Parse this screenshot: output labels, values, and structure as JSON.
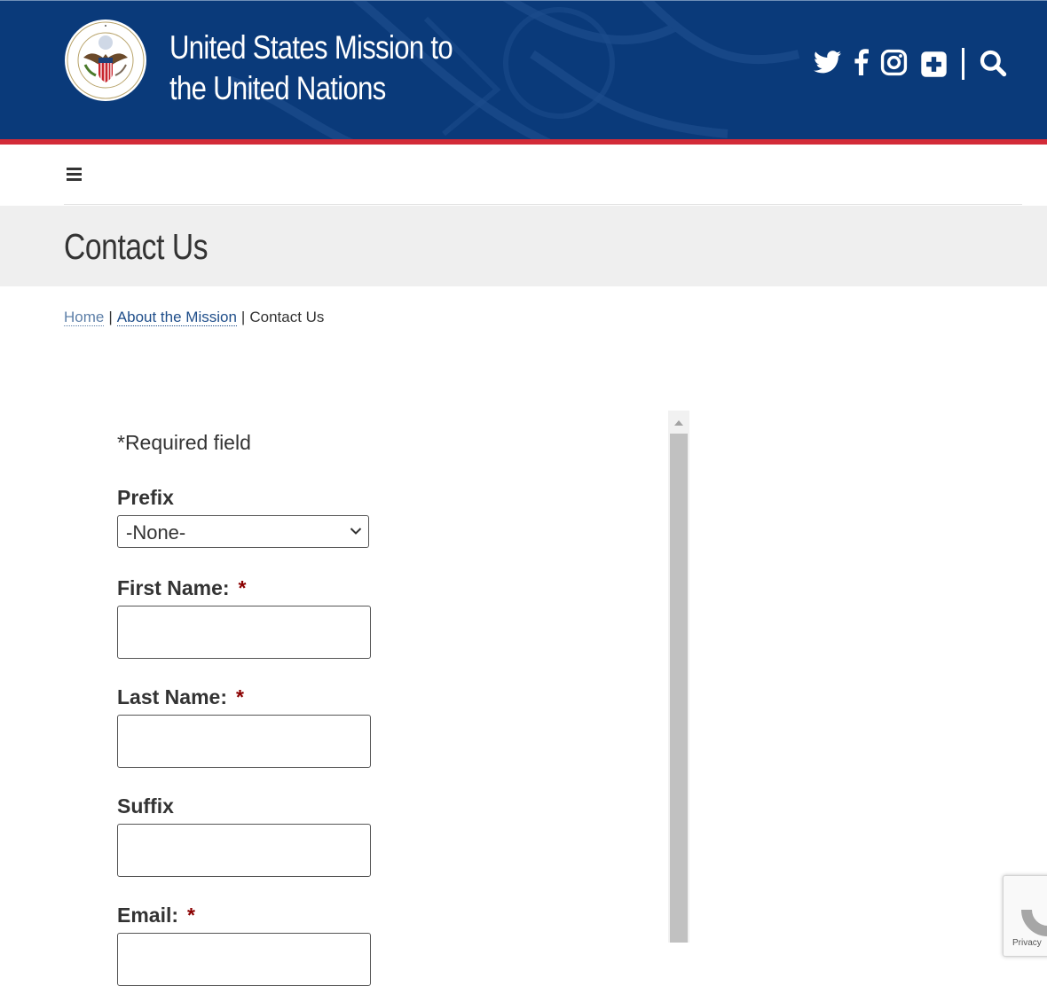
{
  "header": {
    "title_line1": "United States Mission to",
    "title_line2": "the United Nations",
    "seal_icon": "us-mission-seal",
    "social_icons": [
      "twitter-icon",
      "facebook-icon",
      "instagram-icon",
      "plus-box-icon"
    ],
    "search_icon": "search-icon",
    "colors": {
      "primary": "#0a3a7a",
      "accent": "#d32b38"
    }
  },
  "nav": {
    "menu_icon": "hamburger-menu-icon"
  },
  "page": {
    "title": "Contact Us"
  },
  "breadcrumb": {
    "items": [
      "Home",
      "About the Mission",
      "Contact Us"
    ],
    "separator": "|"
  },
  "form": {
    "required_note": "*Required field",
    "required_marker": "*",
    "fields": {
      "prefix": {
        "label": "Prefix",
        "value": "-None-"
      },
      "first_name": {
        "label": "First Name:",
        "value": ""
      },
      "last_name": {
        "label": "Last Name:",
        "value": ""
      },
      "suffix": {
        "label": "Suffix",
        "value": ""
      },
      "email": {
        "label": "Email:",
        "value": ""
      }
    }
  },
  "recaptcha": {
    "label": "Privacy"
  }
}
